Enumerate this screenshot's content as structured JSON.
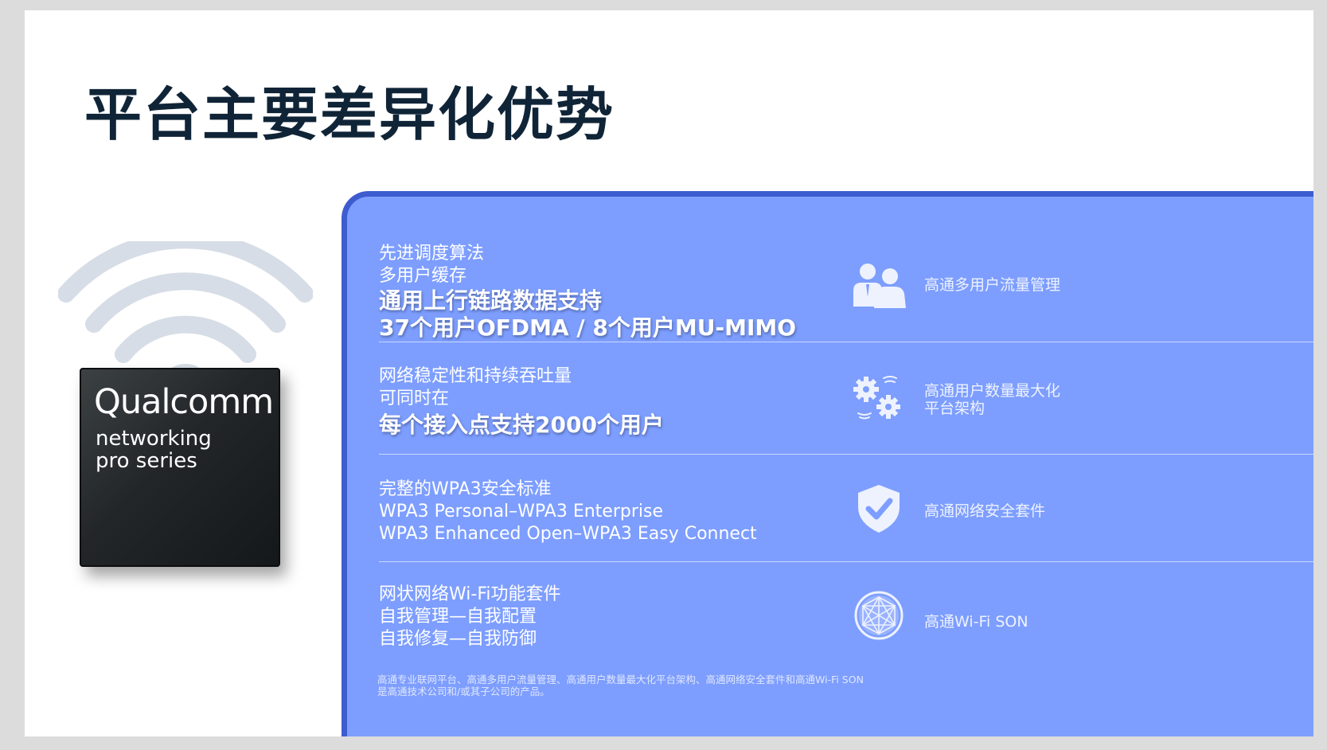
{
  "slide": {
    "title": "平台主要差异化优势",
    "chip": {
      "brand": "Qualcomm",
      "line2": "networking",
      "line3": "pro series"
    },
    "rows": [
      {
        "lines": [
          {
            "text": "先进调度算法",
            "bold": false
          },
          {
            "text": "多用户缓存",
            "bold": false
          },
          {
            "text": "通用上行链路数据支持",
            "bold": true
          },
          {
            "text": "37个用户OFDMA / 8个用户MU-MIMO",
            "bold": true
          }
        ],
        "icon": "users-icon",
        "product": [
          "高通多用户流量管理"
        ]
      },
      {
        "lines": [
          {
            "text": "网络稳定性和持续吞吐量",
            "bold": false
          },
          {
            "text": "可同时在",
            "bold": false
          },
          {
            "text": "每个接入点支持2000个用户",
            "bold": true
          }
        ],
        "icon": "gears-icon",
        "product": [
          "高通用户数量最大化",
          "平台架构"
        ]
      },
      {
        "lines": [
          {
            "text": "完整的WPA3安全标准",
            "bold": false
          },
          {
            "text": "WPA3 Personal–WPA3 Enterprise",
            "bold": false
          },
          {
            "text": "WPA3 Enhanced Open–WPA3 Easy Connect",
            "bold": false
          }
        ],
        "icon": "shield-check-icon",
        "product": [
          "高通网络安全套件"
        ]
      },
      {
        "lines": [
          {
            "text": "网状网络Wi-Fi功能套件",
            "bold": false
          },
          {
            "text": "自我管理—自我配置",
            "bold": false
          },
          {
            "text": "自我修复—自我防御",
            "bold": false
          }
        ],
        "icon": "mesh-network-icon",
        "product": [
          "高通Wi-Fi SON"
        ]
      }
    ],
    "footnote": [
      "高通专业联网平台、高通多用户流量管理、高通用户数量最大化平台架构、高通网络安全套件和高通Wi-Fi SON",
      "是高通技术公司和/或其子公司的产品。"
    ],
    "colors": {
      "title": "#102437",
      "panel": "#7d9eff",
      "panel_border": "#3d5ccf",
      "wifi": "#d6dde6"
    }
  }
}
